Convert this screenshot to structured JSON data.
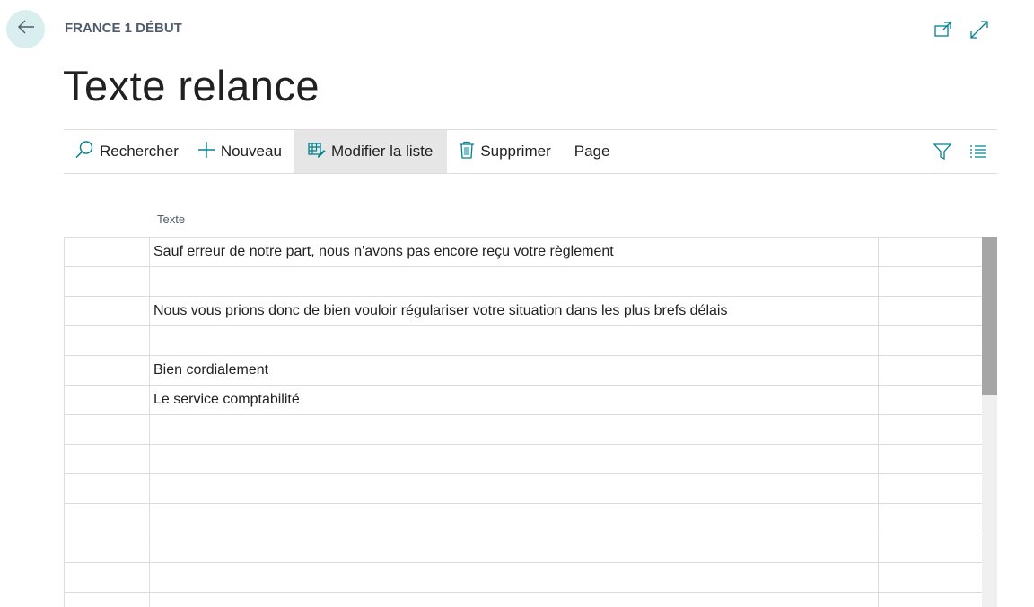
{
  "breadcrumb": "FRANCE 1 DÉBUT",
  "title": "Texte relance",
  "actions": {
    "search": "Rechercher",
    "new": "Nouveau",
    "edit_list": "Modifier la liste",
    "delete": "Supprimer",
    "page": "Page"
  },
  "icons": {
    "back": "arrow-left-icon",
    "open_new_window": "open-new-window-icon",
    "expand": "expand-icon",
    "search": "search-icon",
    "new": "plus-icon",
    "edit_list": "edit-list-icon",
    "delete": "trash-icon",
    "filter": "filter-icon",
    "list_view": "list-view-icon"
  },
  "colors": {
    "accent": "#00838f",
    "back_button_bg": "#d9eeef",
    "active_action_bg": "#e6e6e6"
  },
  "grid": {
    "column_header": "Texte",
    "rows": [
      "Sauf erreur de notre part, nous n'avons pas encore reçu votre règlement",
      "",
      "Nous vous prions donc de bien vouloir régulariser votre situation dans les plus brefs délais",
      "",
      "Bien cordialement",
      "Le service comptabilité",
      "",
      "",
      "",
      "",
      "",
      "",
      ""
    ]
  }
}
